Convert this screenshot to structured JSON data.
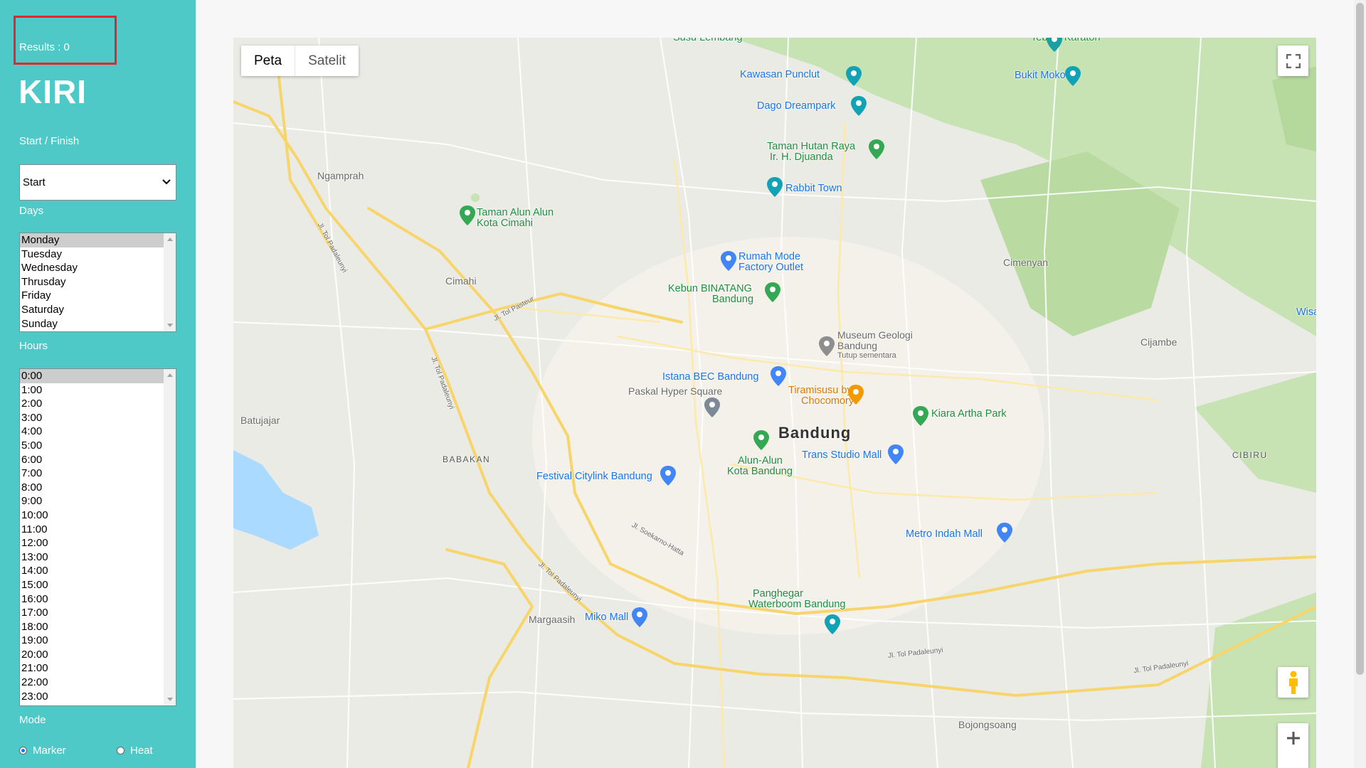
{
  "sidebar": {
    "results": "Results : 0",
    "brand": "KIRI",
    "start_finish_label": "Start / Finish",
    "start_finish_value": "Start",
    "days_label": "Days",
    "days": [
      "Monday",
      "Tuesday",
      "Wednesday",
      "Thrusday",
      "Friday",
      "Saturday",
      "Sunday"
    ],
    "days_selected": "Monday",
    "hours_label": "Hours",
    "hours": [
      "0:00",
      "1:00",
      "2:00",
      "3:00",
      "4:00",
      "5:00",
      "6:00",
      "7:00",
      "8:00",
      "9:00",
      "10:00",
      "11:00",
      "12:00",
      "13:00",
      "14:00",
      "15:00",
      "16:00",
      "17:00",
      "18:00",
      "19:00",
      "20:00",
      "21:00",
      "22:00",
      "23:00"
    ],
    "hours_selected": "0:00",
    "mode_label": "Mode",
    "mode_options": [
      "Marker",
      "Heat"
    ],
    "mode_selected": "Marker"
  },
  "map": {
    "type_buttons": [
      "Peta",
      "Satelit"
    ],
    "type_selected": "Peta",
    "controls": [
      "fullscreen-icon",
      "pegman-icon",
      "zoom-in-icon"
    ],
    "colors": {
      "accent": "#4ec9c8",
      "road_major": "#f8d56b",
      "park": "#c7e3b3",
      "water": "#aadaff",
      "poi": "#1a73e8",
      "green_poi": "#1e8e3e"
    },
    "labels": {
      "susu_lembang": "Susu Lembang",
      "tebing_karaton": "Tebing Karaton",
      "kawasan_puncul": "Kawasan Punclut",
      "bukit_moko": "Bukit Moko",
      "dago_dreampark": "Dago Dreampark",
      "taman_hutan": "Taman Hutan Raya",
      "taman_hutan_2": "Ir. H. Djuanda",
      "ngamprah": "Ngamprah",
      "rabbit_town": "Rabbit Town",
      "taman_alun": "Taman Alun Alun",
      "taman_alun_2": "Kota Cimahi",
      "rumah_mode": "Rumah Mode",
      "rumah_mode_2": "Factory Outlet",
      "cimenyan": "Cimenyan",
      "wisa": "Wisa",
      "cimahi": "Cimahi",
      "kebun_binatang": "Kebun BINATANG",
      "kebun_binatang_2": "Bandung",
      "museum_geologi": "Museum Geologi",
      "museum_geologi_2": "Bandung",
      "museum_geologi_3": "Tutup sementara",
      "cijambe": "Cijambe",
      "istana_bec": "Istana BEC Bandung",
      "paskal": "Paskal Hyper Square",
      "tiramisusu": "Tiramisusu by",
      "tiramisusu_2": "Chocomory",
      "kiara_artha": "Kiara Artha Park",
      "batujajar": "Batujajar",
      "bandung": "Bandung",
      "babakan": "BABAKAN",
      "cibiru": "CIBIRU",
      "trans_studio": "Trans Studio Mall",
      "alun_alun": "Alun-Alun",
      "alun_alun_2": "Kota Bandung",
      "festival_citylink": "Festival Citylink Bandung",
      "metro_indah": "Metro Indah Mall",
      "panghegar": "Panghegar",
      "panghegar_2": "Waterboom Bandung",
      "margaasih": "Margaasih",
      "miko_mall": "Miko Mall",
      "bojongsoang": "Bojongsoang"
    },
    "road_labels": {
      "tol_padaleunyi_1": "Jl. Tol Padaleunyi",
      "tol_padaleunyi_2": "Jl. Tol Padaleunyi",
      "tol_pasteur": "Jl. Tol Pasteur",
      "tol_padaleunyi_3": "Jl. Tol Padaleunyi",
      "soekarno_hatta": "Jl. Soekarno-Hatta",
      "tol_padaleunyi_4": "Jl. Tol Padaleunyi",
      "tol_padaleunyi_5": "Jl. Tol Padaleunyi"
    }
  }
}
